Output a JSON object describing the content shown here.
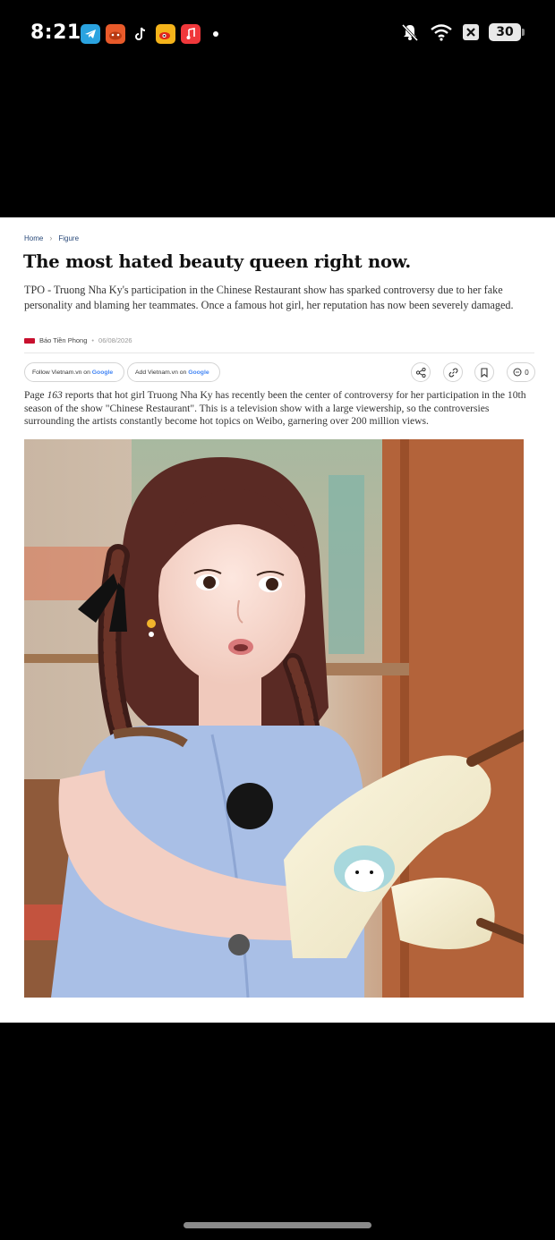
{
  "status_bar": {
    "time": "8:21",
    "battery": "30",
    "app_icons": [
      "telegram-icon",
      "game-app-icon",
      "tiktok-icon",
      "weibo-icon",
      "music-icon"
    ],
    "system_icons": [
      "mute-bell-icon",
      "wifi-icon",
      "no-signal-icon",
      "battery-icon"
    ]
  },
  "article": {
    "breadcrumb": {
      "home": "Home",
      "section": "Figure"
    },
    "title": "The most hated beauty queen right now.",
    "lead": "TPO - Truong Nha Ky's participation in the Chinese Restaurant show has sparked controversy due to her fake personality and blaming her teammates. Once a famous hot girl, her reputation has now been severely damaged.",
    "source": "Báo Tiền Phong",
    "date": "06/08/2026",
    "follow_button": {
      "prefix": "Follow Vietnam.vn on ",
      "brand": "Google"
    },
    "add_button": {
      "prefix": "Add Vietnam.vn on ",
      "brand": "Google"
    },
    "comment_count": "0",
    "body": {
      "lead_in": "Page ",
      "page_ref": "163",
      "rest": " reports that hot girl Truong Nha Ky has recently been the center of controversy for her participation in the 10th season of the show \"Chinese Restaurant\". This is a television show with a large viewership, so the controversies surrounding the artists constantly become hot topics on Weibo, garnering over 200 million views."
    }
  },
  "colors": {
    "accent_red": "#c8102e",
    "link_blue": "#2a4a7a",
    "google_blue": "#4285f4",
    "dress_blue": "#a9bfe6"
  }
}
